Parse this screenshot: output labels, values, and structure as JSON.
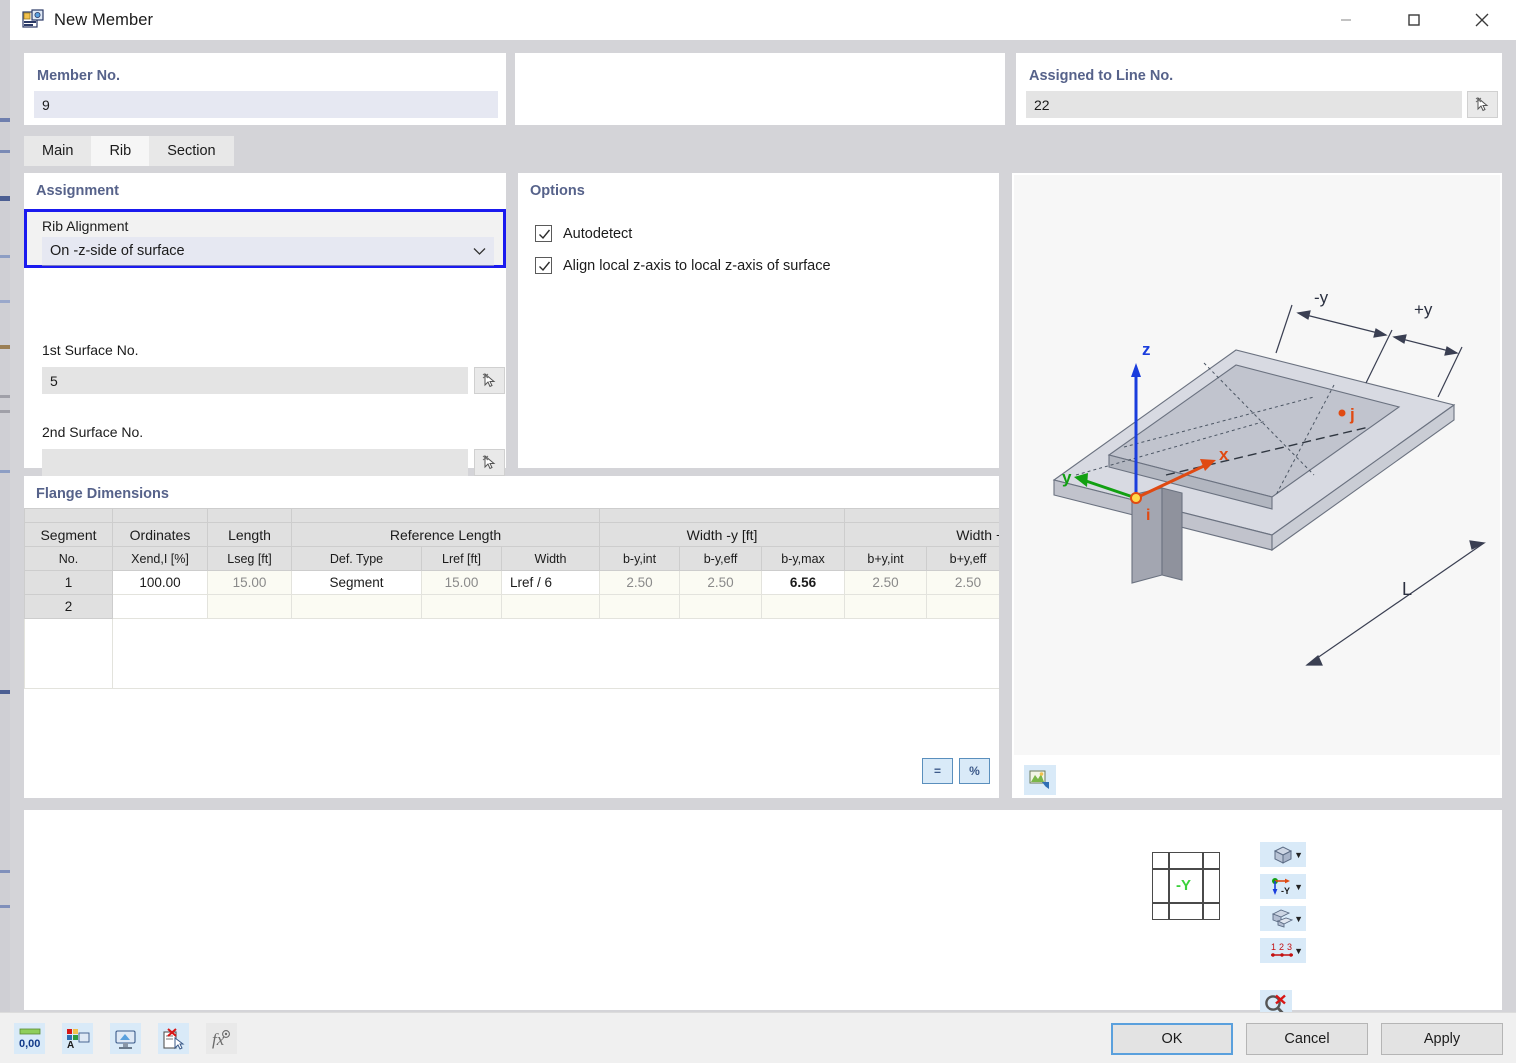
{
  "window": {
    "title": "New Member",
    "icon": "member-icon",
    "minimize": "minimize-icon",
    "maximize": "maximize-icon",
    "close": "close-icon"
  },
  "header": {
    "member_no": {
      "label": "Member No.",
      "value": "9"
    },
    "middle": {
      "value": ""
    },
    "assigned_line": {
      "label": "Assigned to Line No.",
      "value": "22",
      "pick_icon": "pick-cursor-icon"
    }
  },
  "tabs": [
    {
      "label": "Main",
      "active": false
    },
    {
      "label": "Rib",
      "active": true
    },
    {
      "label": "Section",
      "active": false
    }
  ],
  "assignment": {
    "title": "Assignment",
    "rib_alignment": {
      "label": "Rib Alignment",
      "value": "On -z-side of surface",
      "chevron": "chevron-down-icon"
    },
    "first_surface": {
      "label": "1st Surface No.",
      "value": "5",
      "pick_icon": "pick-cursor-icon"
    },
    "second_surface": {
      "label": "2nd Surface No.",
      "value": "",
      "pick_icon": "pick-cursor-icon"
    }
  },
  "options": {
    "title": "Options",
    "items": [
      {
        "label": "Autodetect",
        "checked": true
      },
      {
        "label": "Align local z-axis to local z-axis of surface",
        "checked": true
      }
    ]
  },
  "flange": {
    "title": "Flange Dimensions",
    "group_headers": [
      {
        "label": "Segment",
        "sub": "No."
      },
      {
        "label": "Ordinates",
        "sub": "Xend,I [%]"
      },
      {
        "label": "Length",
        "sub": "Lseg [ft]"
      },
      {
        "label": "Reference Length",
        "subs": [
          "Def. Type",
          "Lref [ft]",
          "Width"
        ]
      },
      {
        "label": "Width -y [ft]",
        "subs": [
          "b-y,int",
          "b-y,eff",
          "b-y,max"
        ]
      },
      {
        "label": "Width +y [f",
        "subs": [
          "b+y,int",
          "b+y,eff"
        ]
      }
    ],
    "rows": [
      {
        "no": "1",
        "cells": [
          {
            "value": "100.00",
            "style": "editable"
          },
          {
            "value": "15.00",
            "style": "readonly"
          },
          {
            "value": "Segment",
            "style": "editable"
          },
          {
            "value": "15.00",
            "style": "readonly"
          },
          {
            "value": "Lref / 6",
            "style": "editable"
          },
          {
            "value": "2.50",
            "style": "readonly"
          },
          {
            "value": "2.50",
            "style": "readonly"
          },
          {
            "value": "6.56",
            "style": "bold"
          },
          {
            "value": "2.50",
            "style": "readonly"
          },
          {
            "value": "2.50",
            "style": "readonly"
          }
        ]
      },
      {
        "no": "2",
        "cells": [
          {
            "value": "",
            "style": "editable"
          },
          {
            "value": "",
            "style": "readonly"
          },
          {
            "value": "",
            "style": "readonly"
          },
          {
            "value": "",
            "style": "readonly"
          },
          {
            "value": "",
            "style": "editable"
          },
          {
            "value": "",
            "style": "readonly"
          },
          {
            "value": "",
            "style": "readonly"
          },
          {
            "value": "",
            "style": "editable"
          },
          {
            "value": "",
            "style": "readonly"
          },
          {
            "value": "",
            "style": "readonly"
          }
        ]
      }
    ],
    "scroll": {
      "left_arrow": "chevron-left-icon",
      "right_arrow": "chevron-right-icon"
    },
    "tools": [
      {
        "label": "=",
        "name": "equals-button"
      },
      {
        "label": "%",
        "name": "percent-button"
      }
    ]
  },
  "preview": {
    "axes": {
      "x": "x",
      "y": "y",
      "z": "z"
    },
    "nodes": {
      "start": "i",
      "end": "j"
    },
    "dimensions": {
      "minus_y": "-y",
      "plus_y": "+y",
      "length": "L"
    },
    "settings_icon": "render-settings-icon"
  },
  "viewbar": {
    "cube_label": "-Y",
    "buttons": [
      {
        "name": "view-mode-button",
        "icon": "cube-icon",
        "chevron": "chevron-down-icon"
      },
      {
        "name": "axis-orientation-button",
        "icon": "axis-icon",
        "label": "-Y",
        "chevron": "chevron-down-icon"
      },
      {
        "name": "render-style-button",
        "icon": "solid-icon",
        "chevron": "chevron-down-icon"
      },
      {
        "name": "numbering-button",
        "icon": "numbering-icon",
        "label": "1 2 3",
        "chevron": "chevron-down-icon"
      },
      {
        "name": "clear-selection-button",
        "icon": "magnifier-clear-icon"
      }
    ]
  },
  "footer": {
    "tools": [
      {
        "name": "units-button",
        "icon": "decimal-places-icon",
        "label": "0,00"
      },
      {
        "name": "display-properties-button",
        "icon": "colors-icon"
      },
      {
        "name": "view-button",
        "icon": "monitor-icon"
      },
      {
        "name": "delete-button",
        "icon": "delete-doc-icon"
      },
      {
        "name": "formula-button",
        "icon": "fx-icon",
        "label": "fx"
      }
    ],
    "buttons": [
      {
        "label": "OK",
        "name": "ok-button",
        "primary": true
      },
      {
        "label": "Cancel",
        "name": "cancel-button",
        "primary": false
      },
      {
        "label": "Apply",
        "name": "apply-button",
        "primary": false
      }
    ]
  },
  "colors": {
    "accent_blue": "#1a1aef",
    "header_label": "#56628a",
    "field_bg": "#e6e8f2",
    "axis_x": "#e04a12",
    "axis_y": "#12a012",
    "axis_z": "#1a3ddd"
  }
}
